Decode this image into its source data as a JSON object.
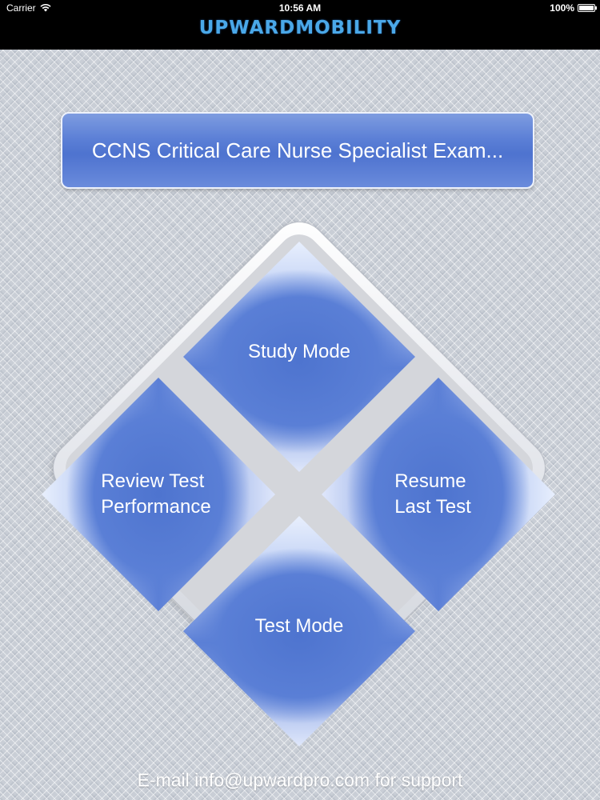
{
  "status_bar": {
    "carrier": "Carrier",
    "time": "10:56 AM",
    "battery": "100%"
  },
  "header": {
    "logo_text": "UPWARDMOBILITY"
  },
  "title_button": {
    "label": "CCNS Critical Care Nurse Specialist Exam..."
  },
  "menu": {
    "study_mode": "Study Mode",
    "review_line1": "Review Test",
    "review_line2": "Performance",
    "resume_line1": "Resume",
    "resume_line2": "Last Test",
    "test_mode": "Test Mode"
  },
  "footer": {
    "support_text": "E-mail info@upwardpro.com for support"
  },
  "colors": {
    "button_blue": "#5b7fd6",
    "header_black": "#000000",
    "logo_blue": "#4aa8e8"
  }
}
